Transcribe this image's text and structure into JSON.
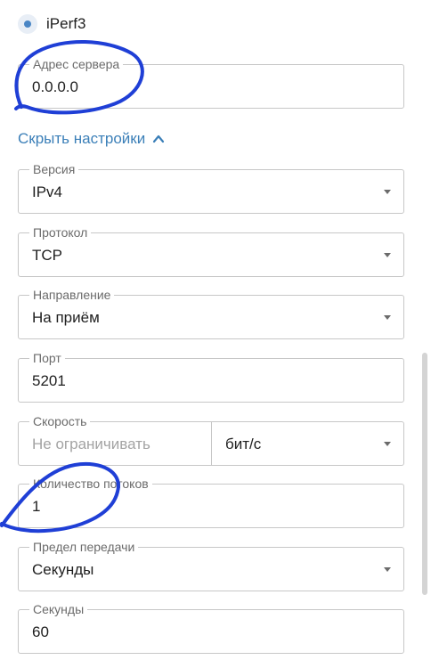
{
  "radio": {
    "label": "iPerf3"
  },
  "server": {
    "label": "Адрес сервера",
    "value": "0.0.0.0"
  },
  "toggle": {
    "label": "Скрыть настройки",
    "icon": "chevron-up-icon"
  },
  "version": {
    "label": "Версия",
    "value": "IPv4"
  },
  "protocol": {
    "label": "Протокол",
    "value": "TCP"
  },
  "direction": {
    "label": "Направление",
    "value": "На приём"
  },
  "port": {
    "label": "Порт",
    "value": "5201"
  },
  "speed": {
    "label": "Скорость",
    "placeholder": "Не ограничивать",
    "unit": "бит/с"
  },
  "streams": {
    "label": "Количество потоков",
    "value": "1"
  },
  "transfer_limit": {
    "label": "Предел передачи",
    "value": "Секунды"
  },
  "seconds": {
    "label": "Секунды",
    "value": "60"
  },
  "colors": {
    "accent": "#3b7fb8",
    "annotation": "#1f3fd6",
    "border": "#c7c7c7"
  }
}
